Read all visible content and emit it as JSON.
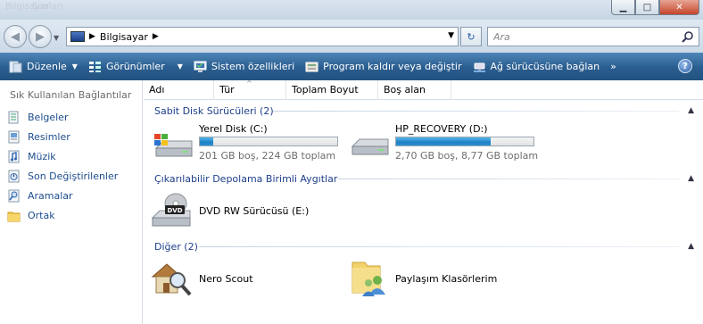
{
  "window": {
    "ghost_text": [
      "Bilgisayar",
      "Sonları"
    ],
    "buttons": {
      "minimize": "▁",
      "maximize": "□",
      "close": "✕"
    }
  },
  "address": {
    "path": "Bilgisayar",
    "search_placeholder": "Ara"
  },
  "toolbar": {
    "items": [
      {
        "label": "Düzenle",
        "icon": "organize-icon",
        "caret": true
      },
      {
        "label": "Görünümler",
        "icon": "views-icon",
        "caret": true
      },
      {
        "label": "Sistem özellikleri",
        "icon": "system-properties-icon",
        "caret": false
      },
      {
        "label": "Program kaldır veya değiştir",
        "icon": "uninstall-icon",
        "caret": false
      },
      {
        "label": "Ağ sürücüsüne bağlan",
        "icon": "map-network-drive-icon",
        "caret": false
      }
    ],
    "more": "»",
    "help": "?"
  },
  "nav": {
    "heading": "Sık Kullanılan Bağlantılar",
    "items": [
      {
        "label": "Belgeler",
        "icon": "documents-icon"
      },
      {
        "label": "Resimler",
        "icon": "pictures-icon"
      },
      {
        "label": "Müzik",
        "icon": "music-icon"
      },
      {
        "label": "Son Değiştirilenler",
        "icon": "recent-changes-icon"
      },
      {
        "label": "Aramalar",
        "icon": "searches-icon"
      },
      {
        "label": "Ortak",
        "icon": "public-folder-icon"
      }
    ]
  },
  "columns": [
    "Adı",
    "Tür",
    "Toplam Boyut",
    "Boş alan"
  ],
  "groups": {
    "hdd": {
      "title": "Sabit Disk Sürücüleri (2)",
      "drives": [
        {
          "name": "Yerel Disk (C:)",
          "info": "201 GB boş, 224 GB toplam",
          "used_fraction": 0.1
        },
        {
          "name": "HP_RECOVERY (D:)",
          "info": "2,70 GB boş, 8,77 GB toplam",
          "used_fraction": 0.69
        }
      ]
    },
    "removable": {
      "title": "Çıkarılabilir Depolama Birimli Aygıtlar",
      "items": [
        {
          "name": "DVD RW Sürücüsü (E:)",
          "badge": "DVD"
        }
      ]
    },
    "other": {
      "title": "Diğer (2)",
      "items": [
        {
          "name": "Nero Scout"
        },
        {
          "name": "Paylaşım Klasörlerim"
        }
      ]
    }
  },
  "colors": {
    "toolbar": "#2a5d8f",
    "link": "#1e4e8f",
    "group": "#1e3f8a",
    "bar": "#1d80c4"
  }
}
